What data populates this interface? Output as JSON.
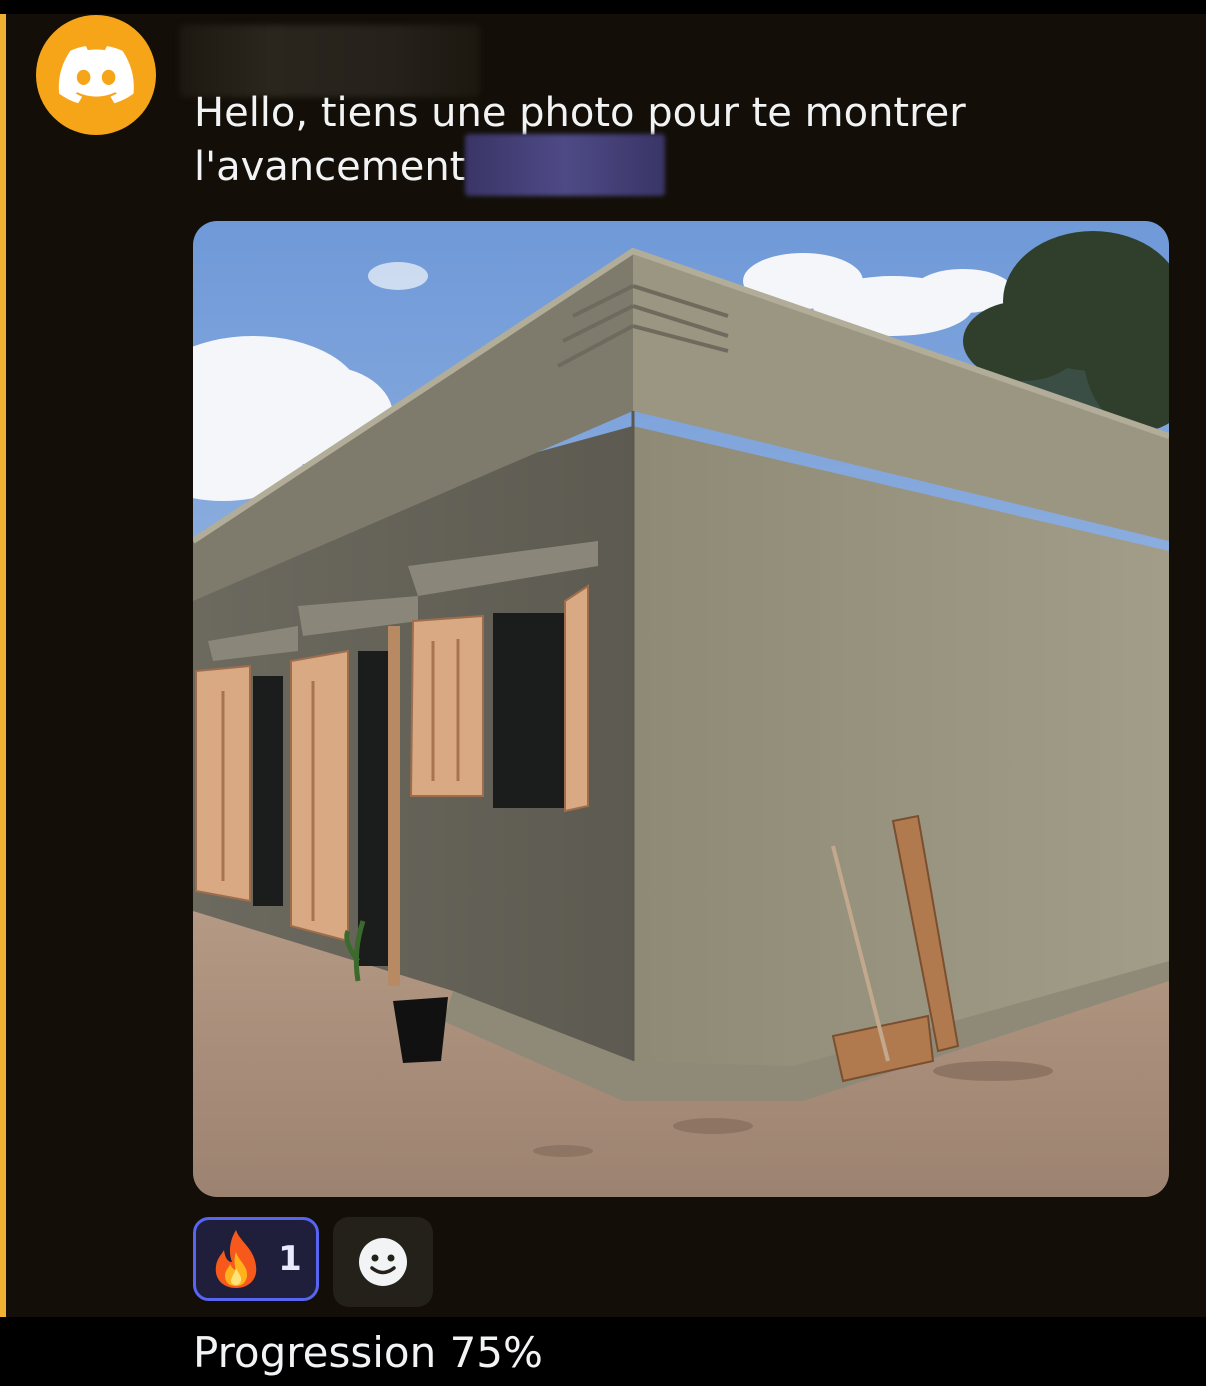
{
  "message": {
    "text": "Hello, tiens une photo pour te montrer\nl'avancement",
    "avatar_icon": "discord-logo-icon",
    "avatar_color": "#f6a518",
    "accent_color": "#f0b132"
  },
  "attachment": {
    "type": "photo"
  },
  "reactions": [
    {
      "emoji": "fire-icon",
      "count": "1"
    }
  ],
  "add_reaction_icon": "smiley-icon",
  "next_message": {
    "text": "Progression 75%"
  }
}
